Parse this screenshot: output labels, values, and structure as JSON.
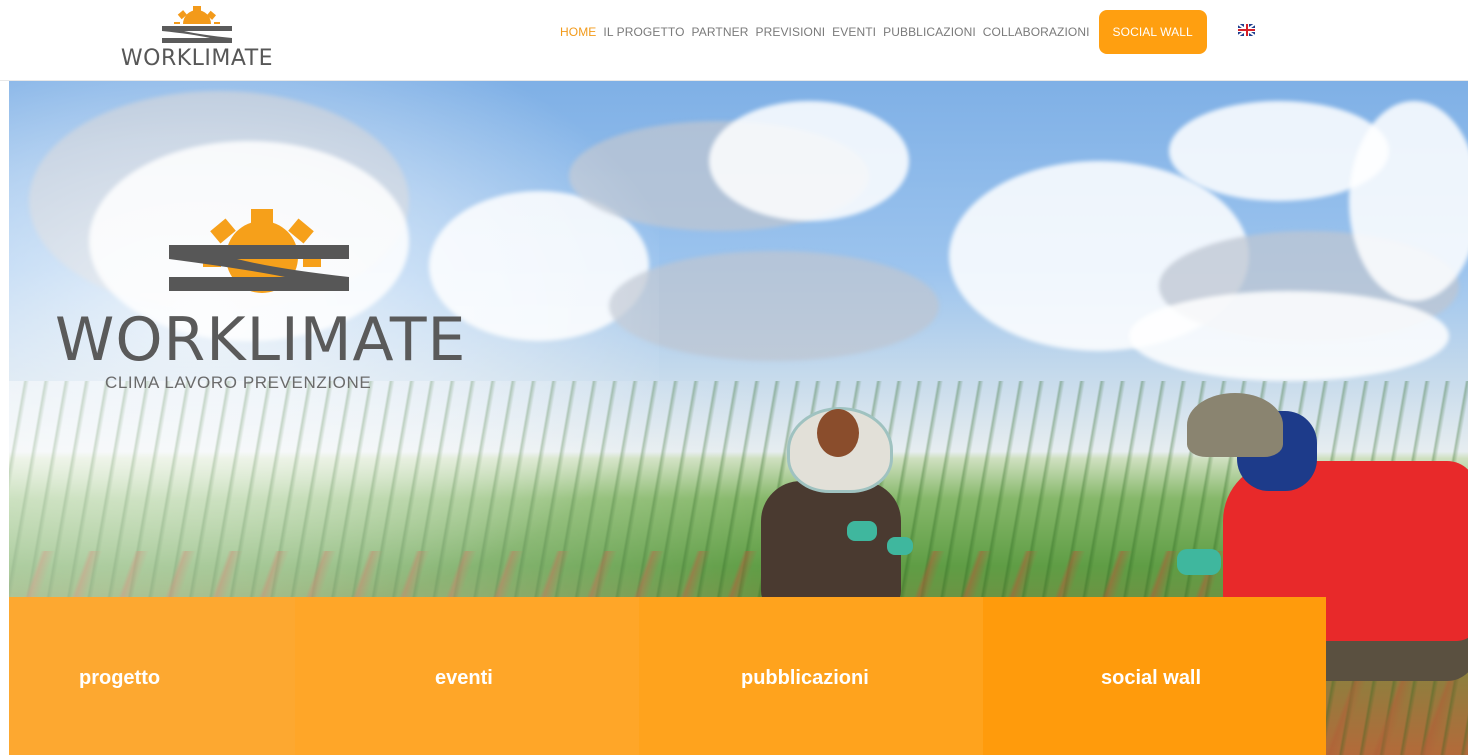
{
  "header": {
    "logo_text": "WORKLIMATE",
    "nav": {
      "home": "HOME",
      "progetto": "IL PROGETTO",
      "partner": "PARTNER",
      "previsioni": "PREVISIONI",
      "eventi": "EVENTI",
      "pubblicazioni": "PUBBLICAZIONI",
      "collaborazioni": "COLLABORAZIONI",
      "social_wall": "SOCIAL WALL"
    },
    "language_icon": "uk-flag-icon"
  },
  "hero": {
    "logo_title": "WORKLIMATE",
    "tagline": "CLIMA LAVORO PREVENZIONE"
  },
  "tiles": [
    {
      "label": "progetto"
    },
    {
      "label": "eventi"
    },
    {
      "label": "pubblicazioni"
    },
    {
      "label": "social wall"
    }
  ],
  "colors": {
    "accent_orange": "#ff9f10",
    "nav_active": "#f29a1a",
    "nav_text": "#7a7a7a",
    "logo_grey": "#575757"
  }
}
